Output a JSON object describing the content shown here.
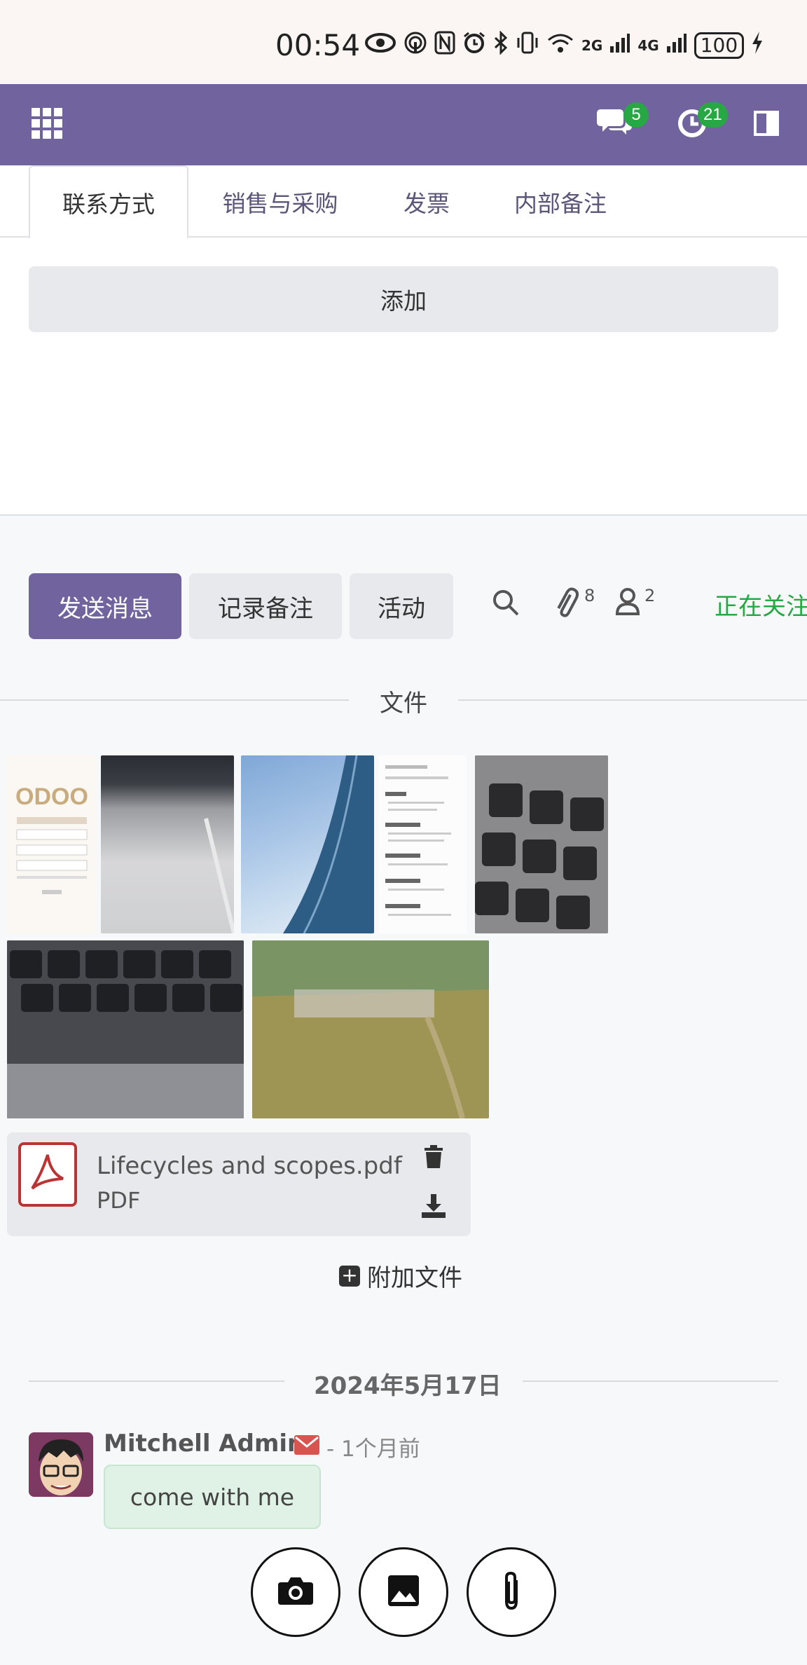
{
  "status_bar": {
    "time": "00:54",
    "network_2g": "2G",
    "network_4g": "4G",
    "battery": "100"
  },
  "navbar": {
    "messages_count": "5",
    "activities_count": "21"
  },
  "tabs": [
    {
      "label": "联系方式"
    },
    {
      "label": "销售与采购"
    },
    {
      "label": "发票"
    },
    {
      "label": "内部备注"
    }
  ],
  "contacts": {
    "add_label": "添加"
  },
  "chatter": {
    "send_message_label": "发送消息",
    "log_note_label": "记录备注",
    "activity_label": "活动",
    "attachments_count": "8",
    "followers_count": "2",
    "following_label": "正在关注"
  },
  "files": {
    "section_title": "文件",
    "pdf_name": "Lifecycles and scopes.pdf",
    "pdf_type": "PDF",
    "attach_label": "附加文件"
  },
  "messages": {
    "date_label": "2024年5月17日",
    "author": "Mitchell Admin",
    "time_ago": "- 1个月前",
    "body": "come with me"
  },
  "colors": {
    "brand": "#71639e",
    "badge": "#28a745",
    "following": "#28a745"
  }
}
